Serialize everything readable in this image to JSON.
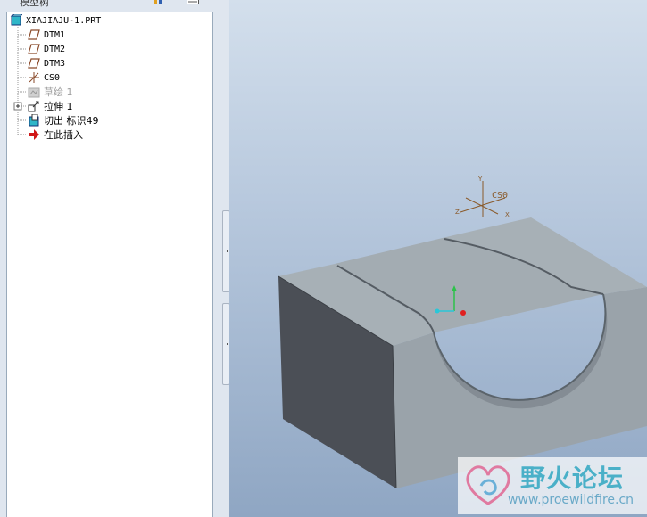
{
  "panel": {
    "title": "模型树"
  },
  "tree": {
    "items": [
      {
        "label": "XIAJIAJU-1.PRT",
        "icon": "part-icon"
      },
      {
        "label": "DTM1",
        "icon": "datum-plane-icon"
      },
      {
        "label": "DTM2",
        "icon": "datum-plane-icon"
      },
      {
        "label": "DTM3",
        "icon": "datum-plane-icon"
      },
      {
        "label": "CS0",
        "icon": "coordinate-system-icon"
      },
      {
        "label": "草绘 1",
        "icon": "sketch-icon"
      },
      {
        "label": "拉伸 1",
        "icon": "extrude-icon"
      },
      {
        "label": "切出 标识49",
        "icon": "cut-icon"
      },
      {
        "label": "在此插入",
        "icon": "insert-here-arrow-icon"
      }
    ]
  },
  "viewport": {
    "csys_label": "CS0",
    "axis_x": "X",
    "axis_y": "Y",
    "axis_z": "Z"
  },
  "watermark": {
    "title": "野火论坛",
    "url": "www.proewildfire.cn"
  },
  "colors": {
    "tree_background": "#ffffff",
    "panel_background": "#dfe6ef",
    "model_top": "#a7b0b6",
    "model_front": "#9aa3aa",
    "model_side": "#4b4f56",
    "csys_color": "#8a5a2a"
  }
}
